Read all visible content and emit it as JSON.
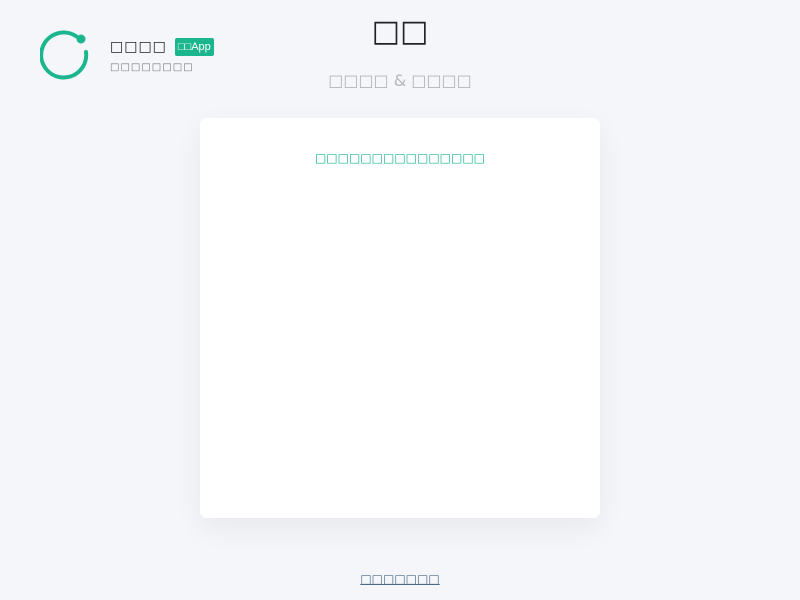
{
  "brand": {
    "name": "□□□□",
    "badge": "□□App",
    "subtitle": "□□□□□□□□",
    "accent_color": "#1bb68d",
    "logo_icon": "circle-logo-icon"
  },
  "header": {
    "title": "□□",
    "subtitle": "□□□□ & □□□□"
  },
  "qr_card": {
    "tip": "□□□□□□□□□□□□□□□"
  },
  "footer": {
    "link_label": "□□□□□□□"
  }
}
